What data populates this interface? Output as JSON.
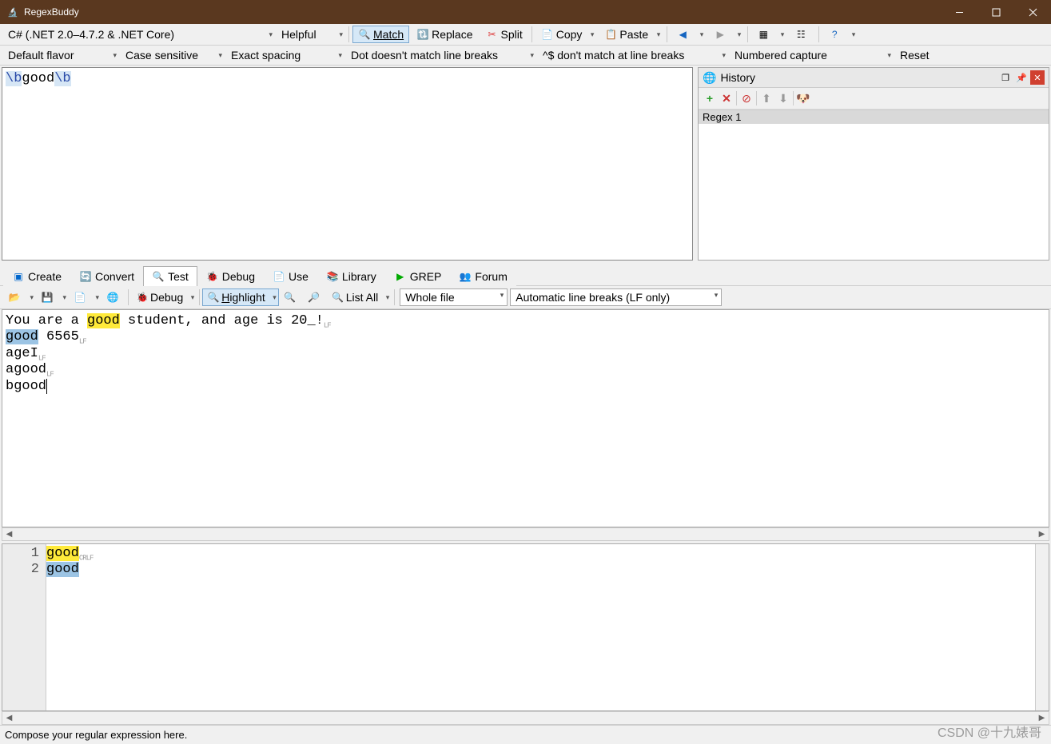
{
  "window": {
    "title": "RegexBuddy"
  },
  "toolbar1": {
    "flavor": "C# (.NET 2.0–4.7.2 & .NET Core)",
    "helpful": "Helpful",
    "match": "Match",
    "replace": "Replace",
    "split": "Split",
    "copy": "Copy",
    "paste": "Paste"
  },
  "toolbar2": {
    "default_flavor": "Default flavor",
    "case": "Case sensitive",
    "spacing": "Exact spacing",
    "dot": "Dot doesn't match line breaks",
    "anchors": "^$ don't match at line breaks",
    "capture": "Numbered capture",
    "reset": "Reset"
  },
  "regex": {
    "prefix": "\\b",
    "body": "good",
    "suffix": "\\b"
  },
  "history": {
    "title": "History",
    "items": [
      "Regex 1"
    ]
  },
  "tabs": {
    "create": "Create",
    "convert": "Convert",
    "test": "Test",
    "debug": "Debug",
    "use": "Use",
    "library": "Library",
    "grep": "GREP",
    "forum": "Forum"
  },
  "test_toolbar": {
    "debug": "Debug",
    "highlight": "Highlight",
    "list_all": "List All",
    "scope": "Whole file",
    "linebreaks": "Automatic line breaks (LF only)"
  },
  "test_text": {
    "line1_pre": "You are a ",
    "line1_match": "good",
    "line1_post": " student, and age is 20_!",
    "line2_match": "good",
    "line2_post": " 6565",
    "line3": "ageI",
    "line4": "agood",
    "line5": "bgood"
  },
  "results": {
    "row1_num": "1",
    "row1_match": "good",
    "row2_num": "2",
    "row2_match": "good"
  },
  "status": "Compose your regular expression here.",
  "watermark": "CSDN @十九婊哥"
}
